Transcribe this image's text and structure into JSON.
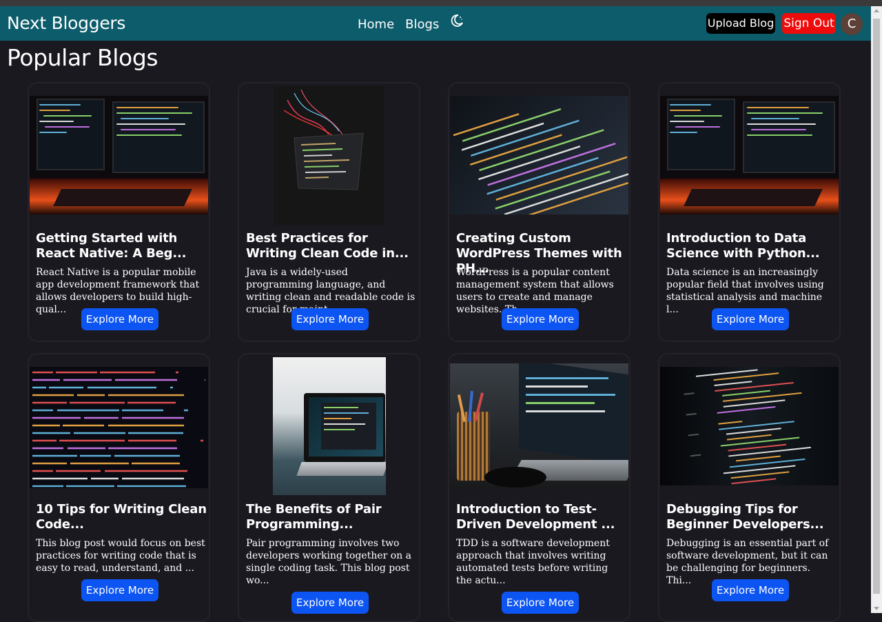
{
  "nav": {
    "brand": "Next Bloggers",
    "links": [
      "Home",
      "Blogs"
    ],
    "theme_icon": "moon-icon",
    "upload_label": "Upload Blog",
    "signout_label": "Sign Out",
    "avatar_initial": "C"
  },
  "page": {
    "title": "Popular Blogs"
  },
  "explore_label": "Explore More",
  "colors": {
    "navbar": "#0c5c6b",
    "background": "#1b1920",
    "explore_button": "#0d55f3",
    "signout": "#ee0b0b",
    "upload": "#000000",
    "avatar": "#5d4037"
  },
  "cards": [
    {
      "title": "Getting Started with React Native: A Beg...",
      "excerpt": "React Native is a popular mobile app development framework that allows developers to build high-qual...",
      "image": "monitors-with-code-red-glow"
    },
    {
      "title": "Best Practices for Writing Clean Code in...",
      "excerpt": "Java is a widely-used programming language, and writing clean and readable code is crucial for maint...",
      "image": "floating-code-screen-neon-lights"
    },
    {
      "title": "Creating Custom WordPress Themes with PH...",
      "excerpt": "WordPress is a popular content management system that allows users to create and manage websites. Th...",
      "image": "angled-code-screen"
    },
    {
      "title": "Introduction to Data Science with Python...",
      "excerpt": "Data science is an increasingly popular field that involves using statistical analysis and machine l...",
      "image": "monitors-with-code-red-glow"
    },
    {
      "title": "10 Tips for Writing Clean Code...",
      "excerpt": "This blog post would focus on best practices for writing code that is easy to read, understand, and ...",
      "image": "javascript-source-code"
    },
    {
      "title": "The Benefits of Pair Programming...",
      "excerpt": "Pair programming involves two developers working together on a single coding task. This blog post wo...",
      "image": "laptop-on-table"
    },
    {
      "title": "Introduction to Test-Driven Development ...",
      "excerpt": "TDD is a software development approach that involves writing automated tests before writing the actu...",
      "image": "laptop-with-pencil-cup"
    },
    {
      "title": "Debugging Tips for Beginner Developers...",
      "excerpt": "Debugging is an essential part of software development, but it can be challenging for beginners. Thi...",
      "image": "python-code-screen"
    }
  ]
}
